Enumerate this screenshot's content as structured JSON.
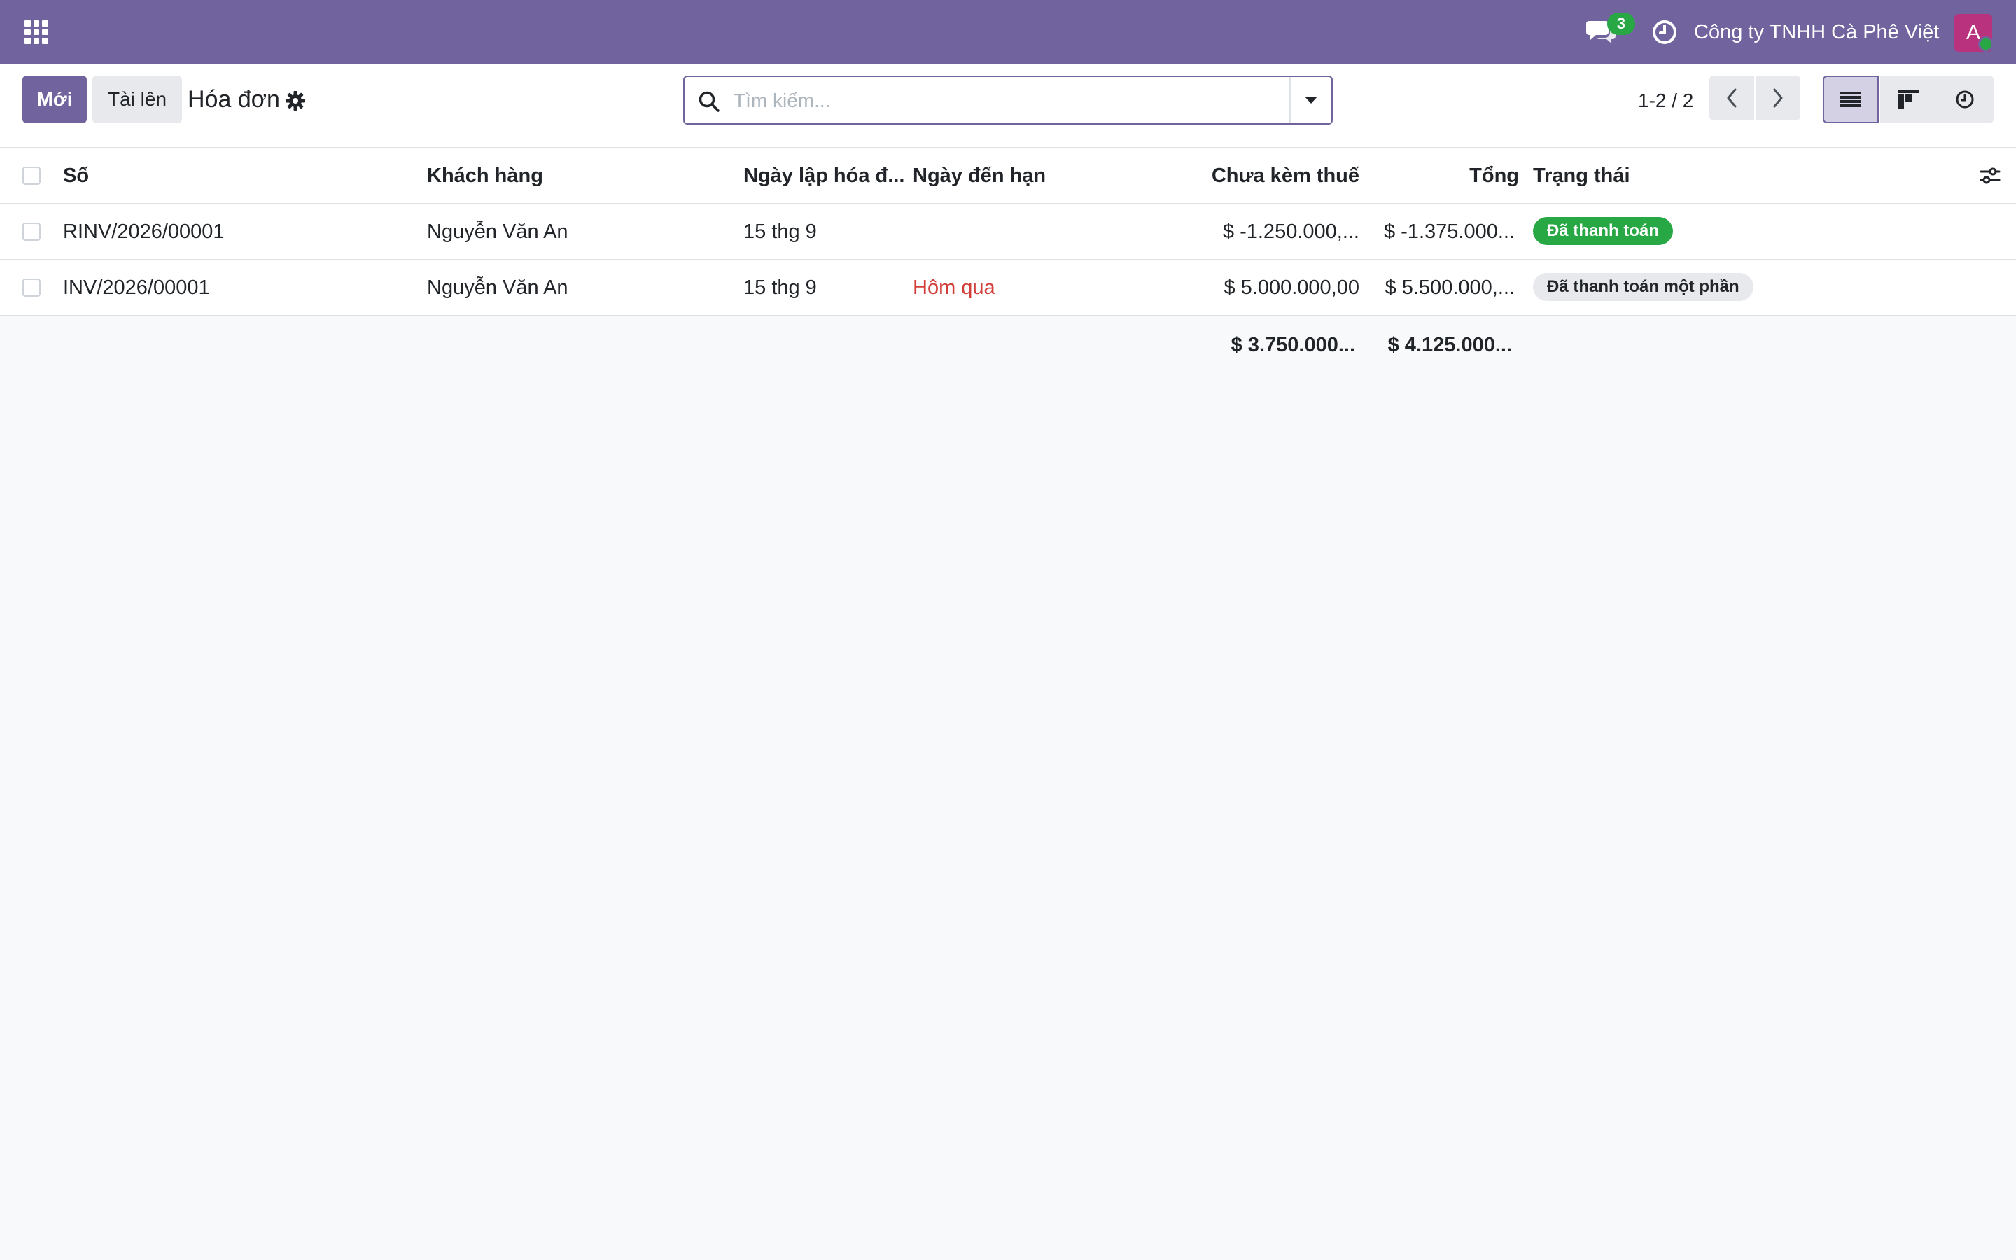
{
  "navbar": {
    "apps_icon": "apps-grid-icon",
    "chat_icon": "chat-icon",
    "chat_count": "3",
    "activity_icon": "clock-icon",
    "company": "Công ty TNHH Cà Phê Việt",
    "avatar_letter": "A",
    "brand_color": "#71639e"
  },
  "control": {
    "new_label": "Mới",
    "upload_label": "Tài lên",
    "title": "Hóa đơn",
    "gear_icon": "gear-icon",
    "search_placeholder": "Tìm kiếm...",
    "pager": "1-2 / 2"
  },
  "table": {
    "columns": [
      "Số",
      "Khách hàng",
      "Ngày lập hóa đ...",
      "Ngày đến hạn",
      "Chưa kèm thuế",
      "Tổng",
      "Trạng thái"
    ],
    "rows": [
      {
        "number": "RINV/2026/00001",
        "customer": "Nguyễn Văn An",
        "invoice_date": "15 thg 9",
        "due_date": "",
        "untaxed": "$ -1.250.000,...",
        "total": "$ -1.375.000...",
        "status": "Đã thanh toán",
        "status_color": "#28a745"
      },
      {
        "number": "INV/2026/00001",
        "customer": "Nguyễn Văn An",
        "invoice_date": "15 thg 9",
        "due_date": "Hôm qua",
        "untaxed": "$ 5.000.000,00",
        "total": "$ 5.500.000,...",
        "status": "Đã thanh toán một phần",
        "status_color": "#e7e9ed"
      }
    ],
    "totals": {
      "untaxed": "$ 3.750.000...",
      "total": "$ 4.125.000..."
    }
  }
}
